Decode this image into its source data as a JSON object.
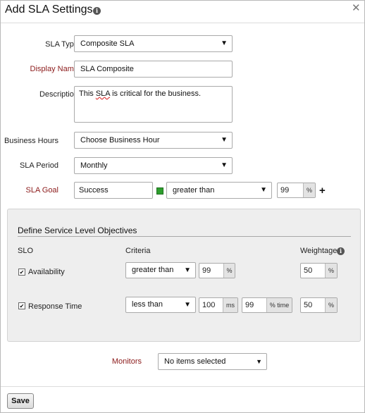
{
  "dialog": {
    "title": "Add SLA Settings",
    "close_symbol": "✕",
    "info_symbol": "i"
  },
  "form": {
    "sla_type": {
      "label": "SLA Type",
      "value": "Composite SLA"
    },
    "display_name": {
      "label": "Display Name",
      "value": "SLA Composite"
    },
    "description": {
      "label": "Description",
      "value_before": "This ",
      "value_spell": "SLA",
      "value_after": " is critical for the business."
    },
    "business_hours": {
      "label": "Business Hours",
      "value": "Choose Business Hour"
    },
    "sla_period": {
      "label": "SLA Period",
      "value": "Monthly"
    },
    "sla_goal": {
      "label": "SLA Goal",
      "status": "Success",
      "status_color": "#2e9e2e",
      "operator": "greater than",
      "value": "99",
      "unit": "%",
      "add_symbol": "+"
    }
  },
  "slo": {
    "section_title": "Define Service Level Objectives",
    "headers": {
      "slo": "SLO",
      "criteria": "Criteria",
      "weightage": "Weightage"
    },
    "rows": [
      {
        "name": "Availability",
        "checked": true,
        "operator": "greater than",
        "value": "99",
        "unit": "%",
        "weight": "50",
        "weight_unit": "%"
      },
      {
        "name": "Response Time",
        "checked": true,
        "operator": "less than",
        "value": "100",
        "unit": "ms",
        "value2": "99",
        "unit2": "% time",
        "weight": "50",
        "weight_unit": "%"
      }
    ]
  },
  "monitors": {
    "label": "Monitors",
    "value": "No items selected"
  },
  "footer": {
    "save_label": "Save"
  },
  "arrows": {
    "down": "▼",
    "caret": "▾"
  },
  "check_mark": "✔"
}
